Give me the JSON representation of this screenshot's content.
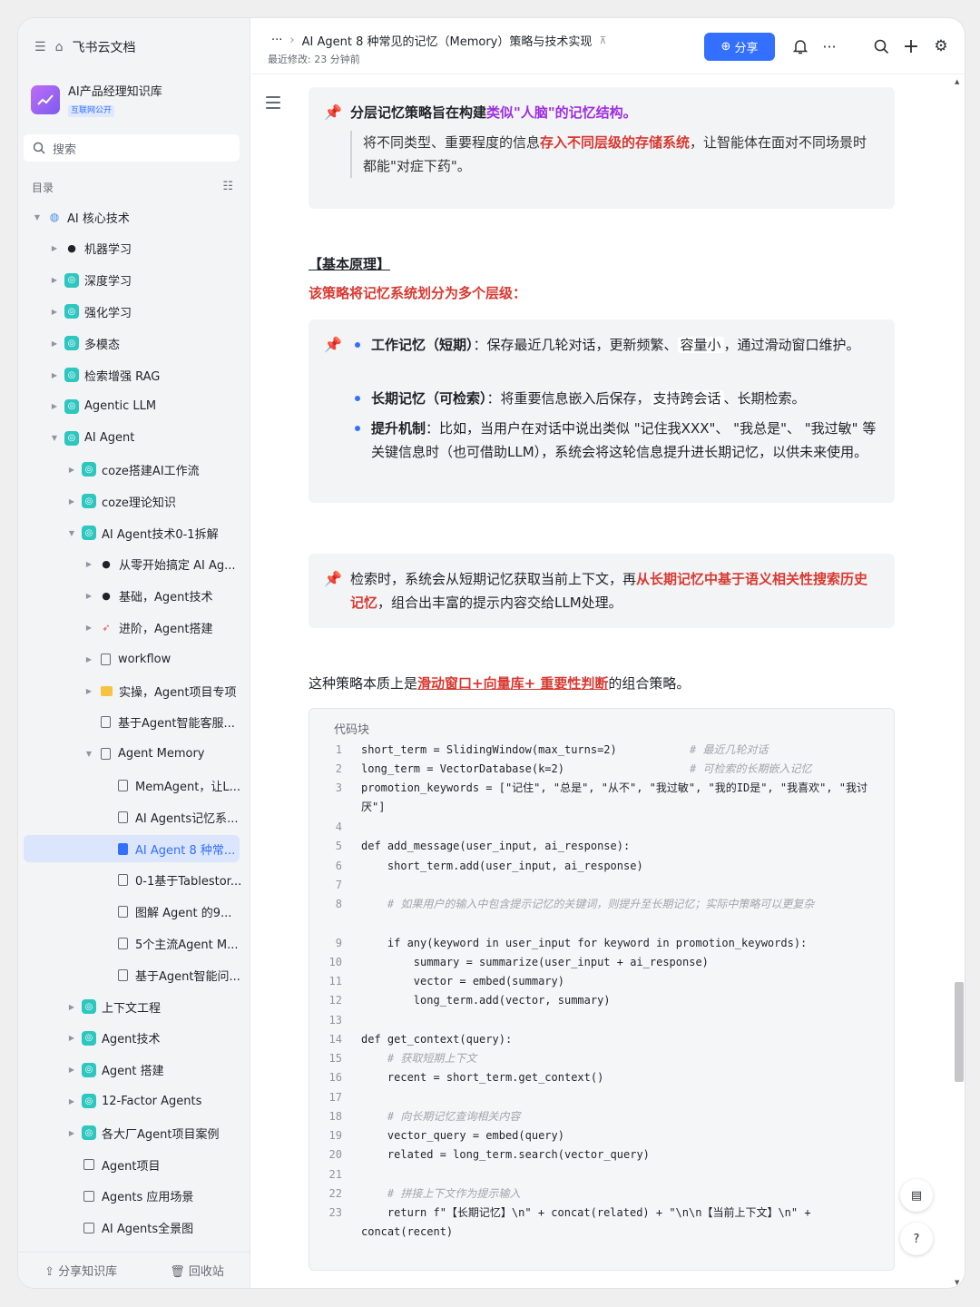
{
  "sidebar": {
    "app_title": "飞书云文档",
    "kb_title": "AI产品经理知识库",
    "kb_badge": "互联网公开",
    "search_placeholder": "搜索",
    "toc_label": "目录",
    "tree": [
      {
        "label": "AI 核心技术",
        "level": 0,
        "icon": "globe-icon",
        "arrow": "down"
      },
      {
        "label": "机器学习",
        "level": 1,
        "icon": "emoji-icon",
        "arrow": "right"
      },
      {
        "label": "深度学习",
        "level": 1,
        "icon": "doc-icon",
        "arrow": "right"
      },
      {
        "label": "强化学习",
        "level": 1,
        "icon": "doc-icon",
        "arrow": "right"
      },
      {
        "label": "多模态",
        "level": 1,
        "icon": "doc-icon",
        "arrow": "right"
      },
      {
        "label": "检索增强 RAG",
        "level": 1,
        "icon": "doc-icon",
        "arrow": "right"
      },
      {
        "label": "Agentic LLM",
        "level": 1,
        "icon": "doc-icon",
        "arrow": "right"
      },
      {
        "label": "AI Agent",
        "level": 1,
        "icon": "doc-icon",
        "arrow": "down"
      },
      {
        "label": "coze搭建AI工作流",
        "level": 2,
        "icon": "doc-icon",
        "arrow": "right"
      },
      {
        "label": "coze理论知识",
        "level": 2,
        "icon": "doc-icon",
        "arrow": "right"
      },
      {
        "label": "AI Agent技术0-1拆解",
        "level": 2,
        "icon": "doc-icon",
        "arrow": "down"
      },
      {
        "label": "从零开始搞定 AI Ag...",
        "level": 3,
        "icon": "emoji-icon",
        "arrow": "right"
      },
      {
        "label": "基础，Agent技术",
        "level": 3,
        "icon": "emoji-icon",
        "arrow": "right"
      },
      {
        "label": "进阶，Agent搭建",
        "level": 3,
        "icon": "rocket-icon",
        "arrow": "right"
      },
      {
        "label": "workflow",
        "level": 3,
        "icon": "page-icon",
        "arrow": "right"
      },
      {
        "label": "实操，Agent项目专项",
        "level": 3,
        "icon": "folder-icon",
        "arrow": "right"
      },
      {
        "label": "基于Agent智能客服...",
        "level": 3,
        "icon": "page-icon",
        "arrow": ""
      },
      {
        "label": "Agent Memory",
        "level": 3,
        "icon": "page-icon",
        "arrow": "down"
      },
      {
        "label": "MemAgent，让L...",
        "level": 4,
        "icon": "page-icon",
        "arrow": ""
      },
      {
        "label": "AI Agents记忆系...",
        "level": 4,
        "icon": "page-icon",
        "arrow": ""
      },
      {
        "label": "AI Agent 8 种常...",
        "level": 4,
        "icon": "page-icon",
        "arrow": "",
        "selected": true
      },
      {
        "label": "0-1基于Tablestor...",
        "level": 4,
        "icon": "page-icon",
        "arrow": ""
      },
      {
        "label": "图解 Agent 的9...",
        "level": 4,
        "icon": "page-icon",
        "arrow": ""
      },
      {
        "label": "5个主流Agent M...",
        "level": 4,
        "icon": "page-icon",
        "arrow": ""
      },
      {
        "label": "基于Agent智能问...",
        "level": 4,
        "icon": "page-icon",
        "arrow": ""
      },
      {
        "label": "上下文工程",
        "level": 2,
        "icon": "doc-icon",
        "arrow": "right"
      },
      {
        "label": "Agent技术",
        "level": 2,
        "icon": "doc-icon",
        "arrow": "right"
      },
      {
        "label": "Agent 搭建",
        "level": 2,
        "icon": "doc-icon",
        "arrow": "right"
      },
      {
        "label": "12-Factor Agents",
        "level": 2,
        "icon": "doc-icon",
        "arrow": "right"
      },
      {
        "label": "各大厂Agent项目案例",
        "level": 2,
        "icon": "doc-icon",
        "arrow": "right"
      },
      {
        "label": "Agent项目",
        "level": 2,
        "icon": "box-icon",
        "arrow": ""
      },
      {
        "label": "Agents 应用场景",
        "level": 2,
        "icon": "box-icon",
        "arrow": ""
      },
      {
        "label": "AI Agents全景图",
        "level": 2,
        "icon": "box-icon",
        "arrow": ""
      }
    ],
    "share_kb": "分享知识库",
    "trash": "回收站"
  },
  "topbar": {
    "breadcrumb_more": "···",
    "doc_title": "AI Agent 8 种常见的记忆（Memory）策略与技术实现",
    "last_modified": "最近修改: 23 分钟前",
    "share_label": "分享"
  },
  "doc": {
    "callout1": {
      "title_a": "分层记忆策略旨在构建",
      "title_b": "类似\"人脑\"的记忆结构。",
      "body_a": "将不同类型、重要程度的信息",
      "body_b": "存入不同层级的存储系统",
      "body_c": "，让智能体在面对不同场景时都能\"对症下药\"。"
    },
    "heading": "【基本原理】",
    "redline": "该策略将记忆系统划分为多个层级：",
    "bullets": {
      "b1_title": "工作记忆（短期）",
      "b1_a": "：保存最近几轮对话，更新频繁、",
      "b1_hl": "容量小",
      "b1_b": "，通过滑动窗口维护。",
      "b2_title": "长期记忆（可检索）",
      "b2_a": "：将重要信息嵌入后保存，",
      "b2_hl": "支持跨会话",
      "b2_b": "、长期检索。",
      "b3_title": "提升机制",
      "b3_a": "：比如，当用户在对话中说出类似 \"记住我XXX\"、 \"我总是\"、 \"我过敏\" 等关键信息时（也可借助LLM），系统会将这轮信息提升进长期记忆，以供未来使用。"
    },
    "callout2": {
      "a": "检索时，系统会从短期记忆获取当前上下文，再",
      "b": "从长期记忆中基于语义相关性搜索历史记忆",
      "c": "，组合出丰富的提示内容交给LLM处理。"
    },
    "tip": {
      "a": "这种策略本质上是",
      "b": "滑动窗口+向量库+ 重要性判断",
      "c": "的组合策略。"
    },
    "code_title": "代码块",
    "code": {
      "l1": "short_term = SlidingWindow(max_turns=2)",
      "l1c": "# 最近几轮对话",
      "l2": "long_term = VectorDatabase(k=2)",
      "l2c": "# 可检索的长期嵌入记忆",
      "l3": "promotion_keywords = [\"记住\", \"总是\", \"从不\", \"我过敏\", \"我的ID是\", \"我喜欢\", \"我讨厌\"]",
      "l5": "def add_message(user_input, ai_response):",
      "l6": "    short_term.add(user_input, ai_response)",
      "l8": "    # 如果用户的输入中包含提示记忆的关键词，则提升至长期记忆；实际中策略可以更复杂",
      "l9": "    if any(keyword in user_input for keyword in promotion_keywords):",
      "l10": "        summary = summarize(user_input + ai_response)",
      "l11": "        vector = embed(summary)",
      "l12": "        long_term.add(vector, summary)",
      "l14": "def get_context(query):",
      "l15": "    # 获取短期上下文",
      "l16": "    recent = short_term.get_context()",
      "l18": "    # 向长期记忆查询相关内容",
      "l19": "    vector_query = embed(query)",
      "l20": "    related = long_term.search(vector_query)",
      "l22": "    # 拼接上下文作为提示输入",
      "l23": "    return f\"【长期记忆】\\n\" + concat(related) + \"\\n\\n【当前上下文】\\n\" + concat(recent)"
    }
  }
}
